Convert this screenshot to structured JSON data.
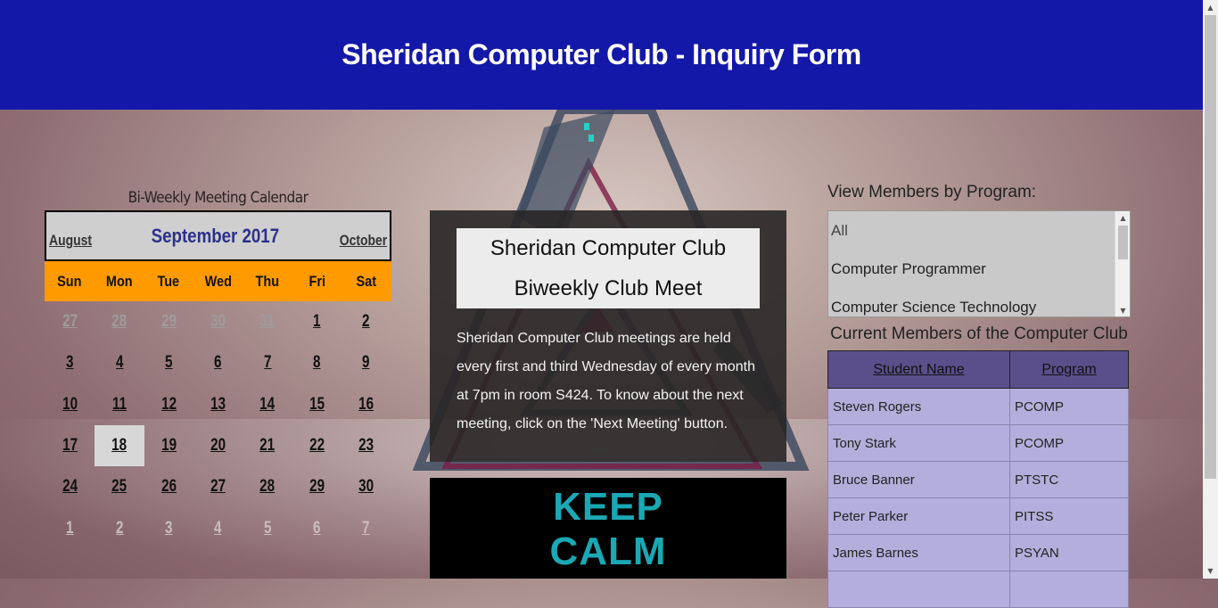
{
  "header": {
    "title": "Sheridan Computer Club - Inquiry Form"
  },
  "calendar": {
    "caption": "Bi-Weekly Meeting Calendar",
    "prev_month": "August",
    "current_month": "September 2017",
    "next_month": "October",
    "weekdays": [
      "Sun",
      "Mon",
      "Tue",
      "Wed",
      "Thu",
      "Fri",
      "Sat"
    ],
    "days": [
      {
        "d": "27",
        "s": "other"
      },
      {
        "d": "28",
        "s": "other"
      },
      {
        "d": "29",
        "s": "other"
      },
      {
        "d": "30",
        "s": "other"
      },
      {
        "d": "31",
        "s": "other"
      },
      {
        "d": "1",
        "s": ""
      },
      {
        "d": "2",
        "s": ""
      },
      {
        "d": "3",
        "s": ""
      },
      {
        "d": "4",
        "s": ""
      },
      {
        "d": "5",
        "s": ""
      },
      {
        "d": "6",
        "s": ""
      },
      {
        "d": "7",
        "s": ""
      },
      {
        "d": "8",
        "s": ""
      },
      {
        "d": "9",
        "s": ""
      },
      {
        "d": "10",
        "s": ""
      },
      {
        "d": "11",
        "s": ""
      },
      {
        "d": "12",
        "s": ""
      },
      {
        "d": "13",
        "s": ""
      },
      {
        "d": "14",
        "s": ""
      },
      {
        "d": "15",
        "s": ""
      },
      {
        "d": "16",
        "s": ""
      },
      {
        "d": "17",
        "s": ""
      },
      {
        "d": "18",
        "s": "today"
      },
      {
        "d": "19",
        "s": ""
      },
      {
        "d": "20",
        "s": ""
      },
      {
        "d": "21",
        "s": ""
      },
      {
        "d": "22",
        "s": ""
      },
      {
        "d": "23",
        "s": ""
      },
      {
        "d": "24",
        "s": ""
      },
      {
        "d": "25",
        "s": ""
      },
      {
        "d": "26",
        "s": ""
      },
      {
        "d": "27",
        "s": ""
      },
      {
        "d": "28",
        "s": ""
      },
      {
        "d": "29",
        "s": ""
      },
      {
        "d": "30",
        "s": ""
      },
      {
        "d": "1",
        "s": "faint"
      },
      {
        "d": "2",
        "s": "faint"
      },
      {
        "d": "3",
        "s": "faint"
      },
      {
        "d": "4",
        "s": "faint"
      },
      {
        "d": "5",
        "s": "faint"
      },
      {
        "d": "6",
        "s": "faint"
      },
      {
        "d": "7",
        "s": "faint"
      }
    ]
  },
  "info": {
    "title_line1": "Sheridan Computer Club",
    "title_line2": "Biweekly Club Meet",
    "body": "Sheridan Computer Club meetings are held every first and third Wednesday of every month at 7pm in room S424. To know about the next meeting, click on the 'Next Meeting' button."
  },
  "poster": {
    "line1": "KEEP",
    "line2": "CALM"
  },
  "members_filter": {
    "label": "View Members by Program:",
    "options": [
      "All",
      "Computer Programmer",
      "Computer Science Technology"
    ]
  },
  "members_table": {
    "caption": "Current Members of the Computer Club",
    "headers": [
      "Student Name",
      "Program"
    ],
    "rows": [
      [
        "Steven Rogers",
        "PCOMP"
      ],
      [
        "Tony Stark",
        "PCOMP"
      ],
      [
        "Bruce Banner",
        "PTSTC"
      ],
      [
        "Peter Parker",
        "PITSS"
      ],
      [
        "James Barnes",
        "PSYAN"
      ]
    ]
  },
  "colors": {
    "header_bg": "#1418a8",
    "weekday_bar": "#ff9a00",
    "table_header": "#5a4f8a",
    "table_row": "#b3aedb",
    "poster_text": "#1aa8b4"
  }
}
